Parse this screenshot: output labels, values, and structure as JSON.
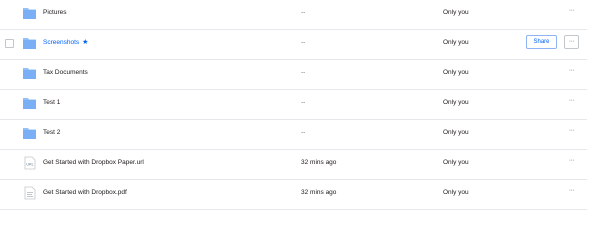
{
  "colors": {
    "folder": "#91c1f9",
    "link": "#0061fe",
    "muted": "#637282",
    "divider": "#e6e8eb"
  },
  "rows": [
    {
      "name": "Pictures",
      "icon": "folder-icon",
      "modified": "--",
      "members": "Only you",
      "more": "···"
    },
    {
      "name": "Screenshots",
      "icon": "folder-icon",
      "starred_icon": "★",
      "modified": "--",
      "members": "Only you",
      "share_label": "Share",
      "more": "···"
    },
    {
      "name": "Tax Documents",
      "icon": "folder-icon",
      "modified": "--",
      "members": "Only you",
      "more": "···"
    },
    {
      "name": "Test 1",
      "icon": "folder-icon",
      "modified": "--",
      "members": "Only you",
      "more": "···"
    },
    {
      "name": "Test 2",
      "icon": "folder-icon",
      "modified": "--",
      "members": "Only you",
      "more": "···"
    },
    {
      "name": "Get Started with Dropbox Paper.url",
      "icon": "url-file-icon",
      "icon_text": "URL",
      "modified": "32 mins ago",
      "members": "Only you",
      "more": "···"
    },
    {
      "name": "Get Started with Dropbox.pdf",
      "icon": "pdf-file-icon",
      "modified": "32 mins ago",
      "members": "Only you",
      "more": "···"
    }
  ]
}
